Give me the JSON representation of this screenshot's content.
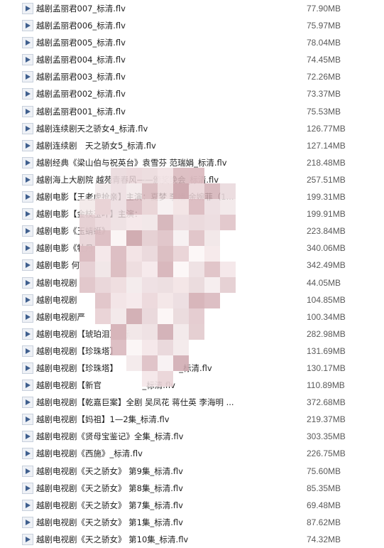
{
  "files": [
    {
      "name": "越剧孟丽君007_标清.flv",
      "size": "77.90MB"
    },
    {
      "name": "越剧孟丽君006_标清.flv",
      "size": "75.97MB"
    },
    {
      "name": "越剧孟丽君005_标清.flv",
      "size": "78.04MB"
    },
    {
      "name": "越剧孟丽君004_标清.flv",
      "size": "74.45MB"
    },
    {
      "name": "越剧孟丽君003_标清.flv",
      "size": "72.26MB"
    },
    {
      "name": "越剧孟丽君002_标清.flv",
      "size": "73.37MB"
    },
    {
      "name": "越剧孟丽君001_标清.flv",
      "size": "75.53MB"
    },
    {
      "name": "越剧连续剧天之骄女4_标清.flv",
      "size": "126.77MB"
    },
    {
      "name": "越剧连续剧　天之骄女5_标清.flv",
      "size": "127.14MB"
    },
    {
      "name": "越剧经典《梁山伯与祝英台》袁雪芬 范瑞娟_标清.flv",
      "size": "218.48MB"
    },
    {
      "name": "越剧海上大剧院 越苑青春风——颁奖晚会_标清.flv",
      "size": "257.51MB"
    },
    {
      "name": "越剧电影【王老虎抢亲】主演：夏梦 李嫱 余婉菲（1...",
      "size": "199.31MB"
    },
    {
      "name": "越剧电影【金枝玉叶】主演：",
      "size": "199.91MB"
    },
    {
      "name": "越剧电影《玉蜻蜓》",
      "size": "223.84MB"
    },
    {
      "name": "越剧电影《牡丹",
      "size": "340.06MB"
    },
    {
      "name": "越剧电影 何",
      "size": "342.49MB"
    },
    {
      "name": "越剧电视剧",
      "size": "44.05MB"
    },
    {
      "name": "越剧电视剧",
      "size": "104.85MB"
    },
    {
      "name": "越剧电视剧严",
      "size": "100.34MB"
    },
    {
      "name": "越剧电视剧【琥珀泪】_标",
      "size": "282.98MB"
    },
    {
      "name": "越剧电视剧【珍珠塔】",
      "size": "131.69MB"
    },
    {
      "name": "越剧电视剧【珍珠塔】　　　　　　　　_标清.flv",
      "size": "130.17MB"
    },
    {
      "name": "越剧电视剧【新官　　　　　_标清.flv",
      "size": "110.89MB"
    },
    {
      "name": "越剧电视剧【乾嘉巨案】全剧 吴凤花 蒋仕英 李海明 ...",
      "size": "372.68MB"
    },
    {
      "name": "越剧电视剧【妈祖】1—2集_标清.flv",
      "size": "219.37MB"
    },
    {
      "name": "越剧电视剧《贤母宝鉴记》全集_标清.flv",
      "size": "303.35MB"
    },
    {
      "name": "越剧电视剧《西施》_标清.flv",
      "size": "226.75MB"
    },
    {
      "name": "越剧电视剧《天之骄女》 第9集_标清.flv",
      "size": "75.60MB"
    },
    {
      "name": "越剧电视剧《天之骄女》 第8集_标清.flv",
      "size": "85.35MB"
    },
    {
      "name": "越剧电视剧《天之骄女》 第7集_标清.flv",
      "size": "69.48MB"
    },
    {
      "name": "越剧电视剧《天之骄女》 第1集_标清.flv",
      "size": "87.62MB"
    },
    {
      "name": "越剧电视剧《天之骄女》 第10集_标清.flv",
      "size": "74.32MB"
    }
  ],
  "colors": {
    "icon_fill": "#3f5f8e",
    "icon_bg": "#eef1f6",
    "text": "#222222",
    "size_text": "#5a5a5a"
  },
  "icon": "video-file-icon"
}
